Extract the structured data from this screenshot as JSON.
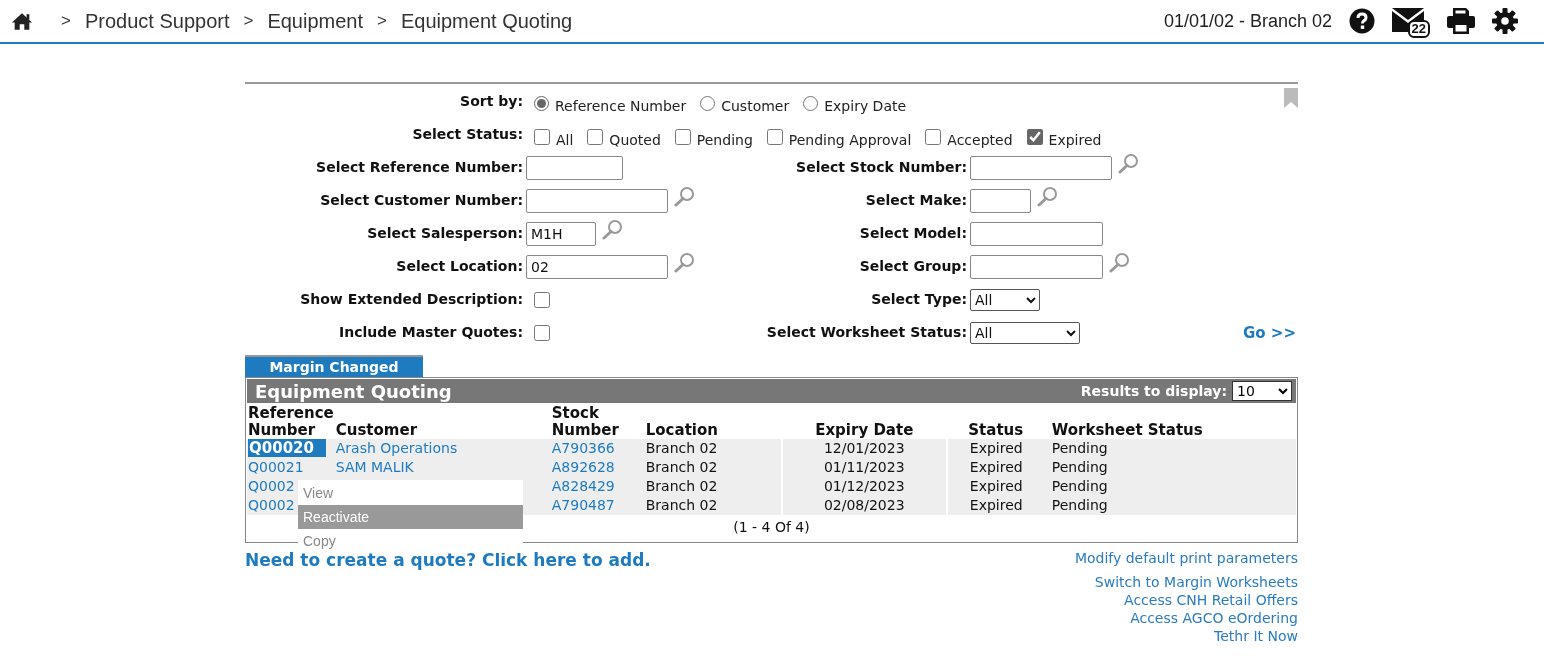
{
  "breadcrumb": {
    "separator": ">",
    "items": [
      "Product Support",
      "Equipment",
      "Equipment Quoting"
    ]
  },
  "header": {
    "branch": "01/01/02 - Branch 02",
    "message_count": "22"
  },
  "filters": {
    "sort_by": {
      "label": "Sort by:",
      "options": [
        {
          "label": "Reference Number",
          "selected": true
        },
        {
          "label": "Customer",
          "selected": false
        },
        {
          "label": "Expiry Date",
          "selected": false
        }
      ]
    },
    "status": {
      "label": "Select Status:",
      "options": [
        {
          "label": "All",
          "checked": false
        },
        {
          "label": "Quoted",
          "checked": false
        },
        {
          "label": "Pending",
          "checked": false
        },
        {
          "label": "Pending Approval",
          "checked": false
        },
        {
          "label": "Accepted",
          "checked": false
        },
        {
          "label": "Expired",
          "checked": true
        }
      ]
    },
    "rows": [
      {
        "left": {
          "label": "Select Reference Number:",
          "kind": "text",
          "lookup": false
        },
        "right": {
          "label": "Select Stock Number:",
          "kind": "text",
          "lookup": true
        }
      },
      {
        "left": {
          "label": "Select Customer Number:",
          "kind": "text",
          "lookup": true
        },
        "right": {
          "label": "Select Make:",
          "kind": "text",
          "lookup": true
        }
      },
      {
        "left": {
          "label": "Select Salesperson:",
          "kind": "text",
          "value": "M1H",
          "lookup": true
        },
        "right": {
          "label": "Select Model:",
          "kind": "text",
          "lookup": false
        }
      },
      {
        "left": {
          "label": "Select Location:",
          "kind": "text",
          "value": "02",
          "lookup": true
        },
        "right": {
          "label": "Select Group:",
          "kind": "text",
          "lookup": true
        }
      },
      {
        "left": {
          "label": "Show Extended Description:",
          "kind": "checkbox",
          "checked": false
        },
        "right": {
          "label": "Select Type:",
          "kind": "select",
          "value": "All"
        }
      },
      {
        "left": {
          "label": "Include Master Quotes:",
          "kind": "checkbox",
          "checked": false
        },
        "right": {
          "label": "Select Worksheet Status:",
          "kind": "select",
          "value": "All"
        }
      }
    ],
    "go": "Go >>"
  },
  "table": {
    "tab": "Margin Changed",
    "title": "Equipment Quoting",
    "results_label": "Results to display:",
    "results_value": "10",
    "header_rows": [
      [
        "Reference",
        null,
        "Stock",
        null,
        null,
        null,
        null
      ],
      [
        "Number",
        "Customer",
        "Number",
        "Location",
        "Expiry Date",
        "Status",
        "Worksheet Status"
      ]
    ],
    "rows": [
      {
        "selected": true,
        "cells": [
          "Q00020",
          "Arash Operations",
          "A790366",
          "Branch 02",
          "12/01/2023",
          "Expired",
          "Pending"
        ]
      },
      {
        "selected": false,
        "cells": [
          "Q00021",
          "SAM MALIK",
          "A892628",
          "Branch 02",
          "01/11/2023",
          "Expired",
          "Pending"
        ]
      },
      {
        "selected": false,
        "cells": [
          "Q0002",
          "",
          "A828429",
          "Branch 02",
          "01/12/2023",
          "Expired",
          "Pending"
        ]
      },
      {
        "selected": false,
        "cells": [
          "Q0002",
          "",
          "A790487",
          "Branch 02",
          "02/08/2023",
          "Expired",
          "Pending"
        ]
      }
    ],
    "pager": "(1 - 4 Of 4)",
    "context_menu": [
      {
        "label": "View",
        "selected": false
      },
      {
        "label": "Reactivate",
        "selected": true
      },
      {
        "label": "Copy",
        "selected": false
      }
    ]
  },
  "add_link": "Need to create a quote? Click here to add.",
  "side_links": [
    "Modify default print parameters",
    "Switch to Margin Worksheets",
    "Access CNH Retail Offers",
    "Access AGCO eOrdering",
    "Tethr It Now"
  ]
}
